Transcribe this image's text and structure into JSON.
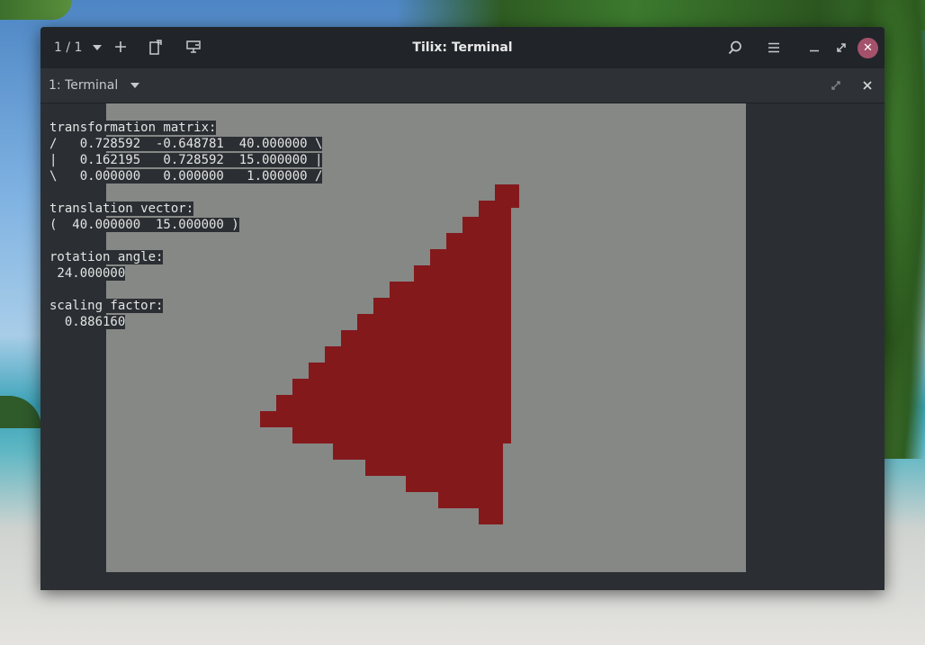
{
  "titlebar": {
    "session_counter": "1 / 1",
    "title": "Tilix: Terminal",
    "icons": {
      "add": "plus-icon",
      "new_terminal": "new-terminal-icon",
      "sync_input": "sync-input-icon",
      "search": "search-icon",
      "menu": "hamburger-menu-icon",
      "minimize": "minimize-icon",
      "maximize": "maximize-icon",
      "close": "close-icon"
    }
  },
  "tab": {
    "label": "1: Terminal"
  },
  "terminal": {
    "lines": [
      "transformation matrix:",
      "/   0.728592  -0.648781  40.000000 \\",
      "|   0.162195   0.728592  15.000000 |",
      "\\   0.000000   0.000000   1.000000 /",
      "",
      "translation vector:",
      "(  40.000000  15.000000 )",
      "",
      "rotation angle:",
      " 24.000000",
      "",
      "scaling factor:",
      "  0.886160"
    ]
  },
  "colors": {
    "window_bg": "#2b2f33",
    "titlebar_bg": "#212529",
    "image_bg": "#858885",
    "triangle_red": "#84191c",
    "close_button": "#a4526c"
  }
}
